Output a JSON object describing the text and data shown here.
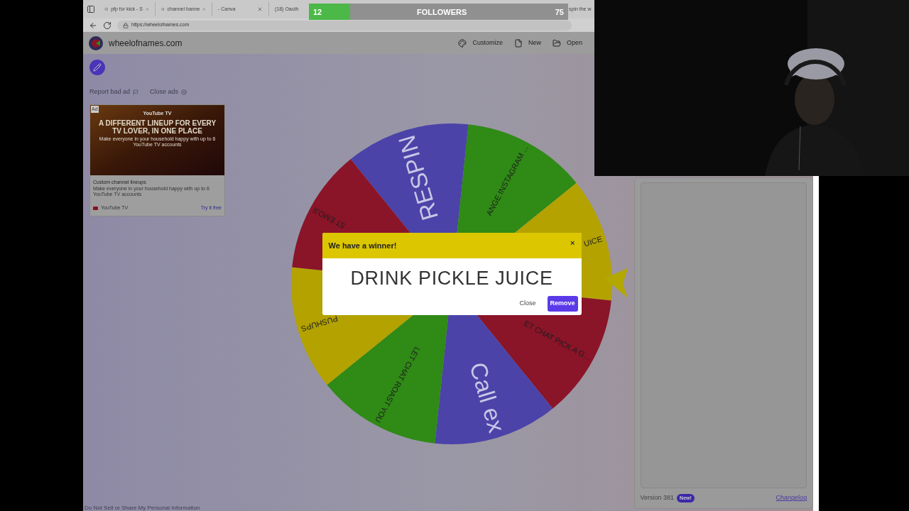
{
  "browser": {
    "tabs": [
      "pfp for kick - S",
      "channel banne",
      "- Canva",
      "(18) Oauth",
      "spin the w"
    ],
    "url": "https://wheelofnames.com"
  },
  "followers": {
    "current": "12",
    "label": "FOLLOWERS",
    "goal": "75",
    "level": 0.16
  },
  "site": {
    "name": "wheelofnames.com",
    "nav": [
      {
        "label": "Customize",
        "kind": "palette"
      },
      {
        "label": "New",
        "kind": "file"
      },
      {
        "label": "Open",
        "kind": "folder"
      }
    ]
  },
  "ads": {
    "report": "Report bad ad",
    "close": "Close ads",
    "card": {
      "badge": "Ad",
      "brand": "YouTube TV",
      "headline": "A DIFFERENT LINEUP FOR EVERY TV LOVER, IN ONE PLACE",
      "subline": "Make everyone in your household happy with up to 6 YouTube TV accounts",
      "title": "Custom channel lineups",
      "description": "Make everyone in your household happy with up to 6 YouTube TV accounts",
      "advertiser": "YouTube TV",
      "cta": "Try it free"
    }
  },
  "wheel": {
    "segments": [
      {
        "label": "RESPIN",
        "color": "#4b43a8",
        "kind": "large"
      },
      {
        "label": "ANGE INSTAGRAM ...",
        "color": "#2f8a16",
        "kind": "small"
      },
      {
        "label": "UICE",
        "color": "#b3a200",
        "kind": "small"
      },
      {
        "label": "ET CHAT PICK A G...",
        "color": "#8a1428",
        "kind": "small"
      },
      {
        "label": "Call ex",
        "color": "#4b43a8",
        "kind": "large"
      },
      {
        "label": "LET CHAT ROAST YOU",
        "color": "#2f8a16",
        "kind": "small"
      },
      {
        "label": "PUSHUPS",
        "color": "#b3a200",
        "kind": "small"
      },
      {
        "label": "ST EMOJI",
        "color": "#8a1428",
        "kind": "small"
      }
    ]
  },
  "dialog": {
    "title": "We have a winner!",
    "close": "×",
    "winner": "DRINK PICKLE JUICE",
    "buttons": [
      {
        "label": "Close",
        "kind": "text"
      },
      {
        "label": "Remove",
        "kind": "primary"
      }
    ]
  },
  "panel": {
    "version": "Version 381",
    "badge": "New!",
    "changelog": "Changelog"
  },
  "footer_link": "Do Not Sell or Share My Personal Information"
}
